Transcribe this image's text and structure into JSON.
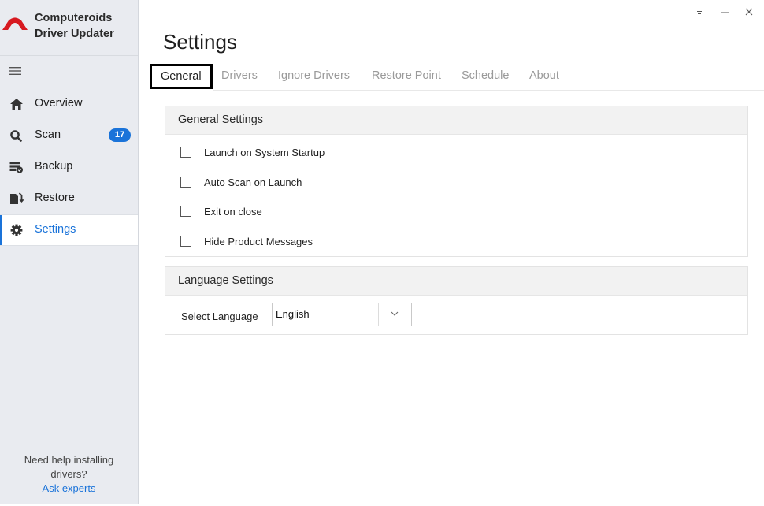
{
  "brand": {
    "line1": "Computeroids",
    "line2": "Driver Updater",
    "logo_color": "#d71920"
  },
  "sidebar": {
    "items": [
      {
        "label": "Overview",
        "icon": "home-icon"
      },
      {
        "label": "Scan",
        "icon": "search-icon",
        "badge": "17"
      },
      {
        "label": "Backup",
        "icon": "backup-icon"
      },
      {
        "label": "Restore",
        "icon": "restore-icon"
      },
      {
        "label": "Settings",
        "icon": "gear-icon",
        "active": true
      }
    ],
    "help_line1": "Need help installing",
    "help_line2": "drivers?",
    "help_link": "Ask experts"
  },
  "page": {
    "title": "Settings",
    "tabs": [
      {
        "label": "General",
        "active": true
      },
      {
        "label": "Drivers"
      },
      {
        "label": "Ignore Drivers"
      },
      {
        "label": "Restore Point"
      },
      {
        "label": "Schedule"
      },
      {
        "label": "About"
      }
    ]
  },
  "general_settings": {
    "header": "General Settings",
    "options": [
      {
        "label": "Launch on System Startup",
        "checked": false
      },
      {
        "label": "Auto Scan on Launch",
        "checked": false
      },
      {
        "label": "Exit on close",
        "checked": false
      },
      {
        "label": "Hide Product Messages",
        "checked": false
      }
    ]
  },
  "language_settings": {
    "header": "Language Settings",
    "label": "Select Language",
    "selected": "English"
  },
  "colors": {
    "accent": "#1a73d9",
    "sidebar_bg": "#e9ebf0",
    "tab_inactive": "#9a9a9a"
  }
}
